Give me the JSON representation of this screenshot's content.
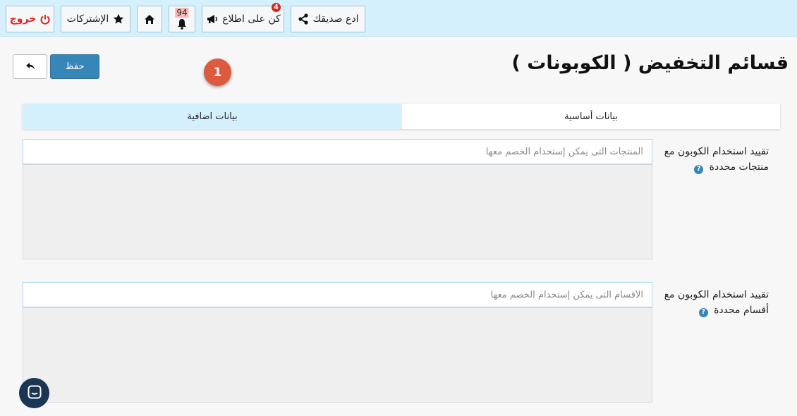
{
  "topbar": {
    "invite_friend": "ادع صديقك",
    "stay_informed": "كن على اطلاع",
    "stay_informed_badge": "4",
    "notifications_count": "94",
    "subscriptions": "الإشتركات",
    "logout": "خروج"
  },
  "header": {
    "title": "قسائم التخفيض ( الكوبونات )",
    "save_label": "حفظ",
    "step_marker": "1"
  },
  "tabs": {
    "basic": "بيانات أساسية",
    "extra": "بيانات اضافية",
    "active": "extra"
  },
  "fields": {
    "products": {
      "label": "تقييد استخدام الكوبون مع منتجات محددة",
      "placeholder": "المنتجات التى يمكن إستخدام الخصم معها"
    },
    "categories": {
      "label": "تقييد استخدام الكوبون مع أقسام محددة",
      "placeholder": "الأقسام التى يمكن إستخدام الخصم معها"
    }
  },
  "colors": {
    "topbar_bg": "#d4f0fd",
    "primary": "#3786b8",
    "logout": "#e0201c",
    "step_marker": "#dd5a3e"
  },
  "icons": [
    "share-icon",
    "megaphone-icon",
    "bell-icon",
    "home-icon",
    "star-icon",
    "power-icon",
    "reply-arrow-icon",
    "question-icon",
    "chat-icon"
  ]
}
